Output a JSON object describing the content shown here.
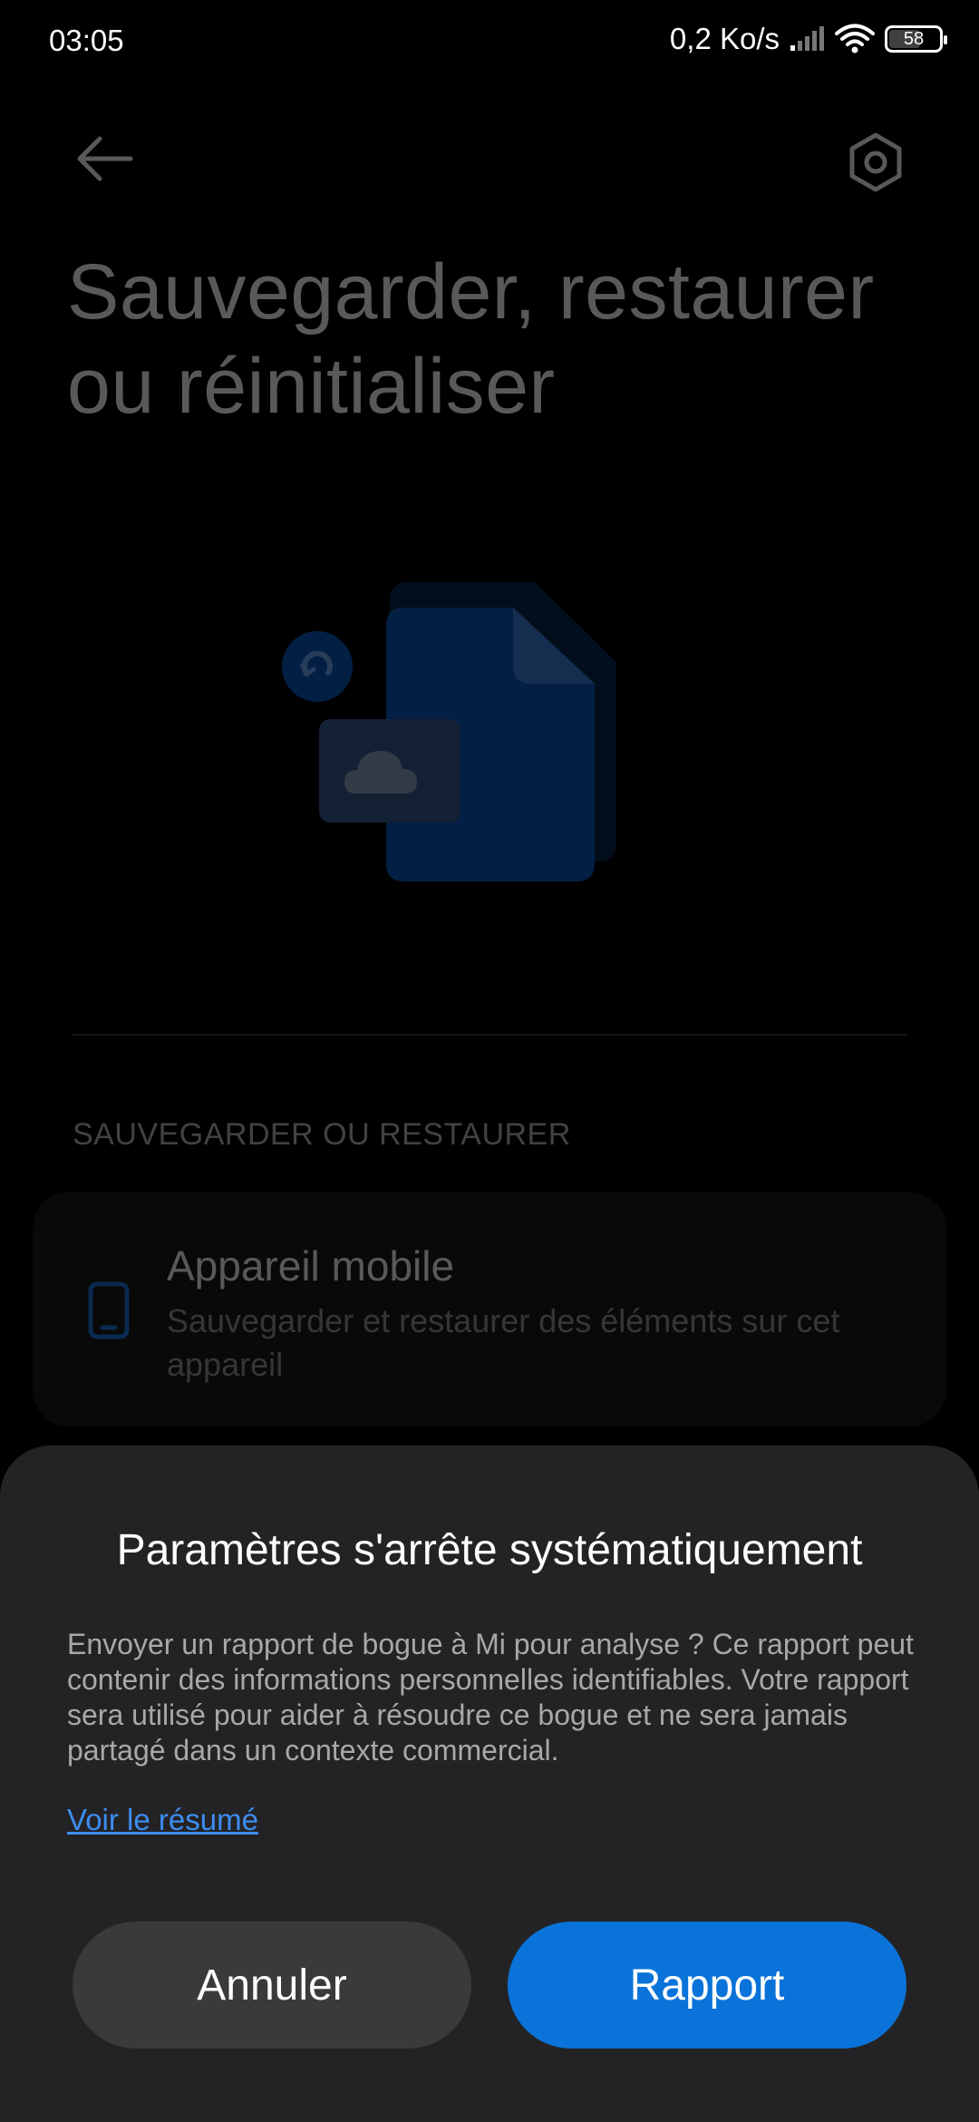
{
  "status_bar": {
    "time": "03:05",
    "net_speed": "0,2 Ko/s",
    "battery": "58"
  },
  "header": {
    "back_icon": "arrow-left-icon",
    "settings_icon": "hexagon-gear-icon",
    "title": "Sauvegarder, restaurer ou réinitialiser"
  },
  "illustration": {
    "icon": "backup-document-cloud-illustration",
    "accent": "#0a4fa3"
  },
  "section": {
    "header": "SAUVEGARDER OU RESTAURER",
    "items": [
      {
        "icon": "phone-icon",
        "title": "Appareil mobile",
        "subtitle": "Sauvegarder et restaurer des éléments sur cet appareil"
      }
    ]
  },
  "dialog": {
    "title": "Paramètres s'arrête systématiquement",
    "message": "Envoyer un rapport de bogue à Mi pour analyse ? Ce rapport peut contenir des informations personnelles identifiables. Votre rapport sera utilisé pour aider à résoudre ce bogue et ne sera jamais partagé dans un contexte commercial.",
    "link": "Voir le résumé",
    "cancel_label": "Annuler",
    "report_label": "Rapport"
  },
  "colors": {
    "background": "#000000",
    "dialog_bg": "#232325",
    "primary_button": "#0a73d9",
    "secondary_button": "#3a3a3c",
    "link": "#3d8df0"
  }
}
